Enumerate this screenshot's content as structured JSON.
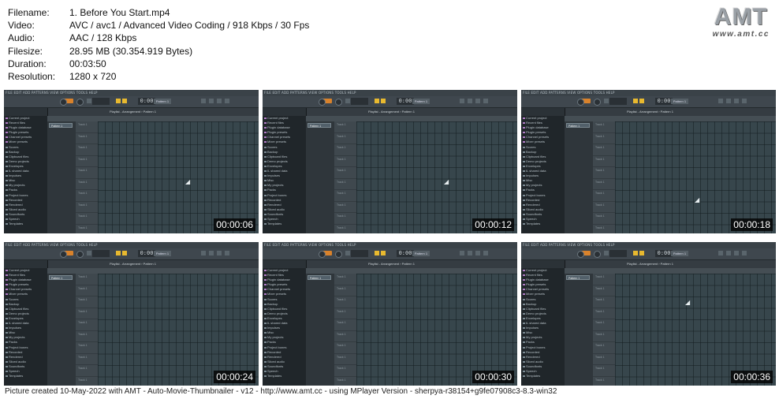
{
  "info": {
    "filename_label": "Filename:",
    "filename": "1. Before You Start.mp4",
    "video_label": "Video:",
    "video": "AVC / avc1 / Advanced Video Coding / 918 Kbps / 30 Fps",
    "audio_label": "Audio:",
    "audio": "AAC / 128 Kbps",
    "filesize_label": "Filesize:",
    "filesize": "28.95 MB (30.354.919 Bytes)",
    "duration_label": "Duration:",
    "duration": "00:03:50",
    "resolution_label": "Resolution:",
    "resolution": "1280 x 720"
  },
  "logo": {
    "text": "AMT",
    "url": "www.amt.cc"
  },
  "thumbnails": [
    {
      "timestamp": "00:00:06"
    },
    {
      "timestamp": "00:00:12"
    },
    {
      "timestamp": "00:00:18"
    },
    {
      "timestamp": "00:00:24"
    },
    {
      "timestamp": "00:00:30"
    },
    {
      "timestamp": "00:00:36"
    }
  ],
  "app": {
    "menu": "FILE EDIT ADD PATTERNS VIEW OPTIONS TOOLS HELP",
    "time": "0:00",
    "pattern_button": "Pattern 1",
    "breadcrumb": "Playlist - Arrangement › Pattern 1",
    "playlist_pattern": "Pattern 1",
    "browser_items": [
      "Current project",
      "Recent files",
      "Plugin database",
      "Plugin presets",
      "Channel presets",
      "Mixer presets",
      "Scores",
      "Backup",
      "Clipboard files",
      "Demo projects",
      "Envelopes",
      "IL shared data",
      "Impulses",
      "Misc",
      "My projects",
      "Packs",
      "Project bones",
      "Recorded",
      "Rendered",
      "Sliced audio",
      "Soundfonts",
      "Speech",
      "Templates"
    ],
    "track_label": "Track 1"
  },
  "footer": "Picture created 10-May-2022 with AMT - Auto-Movie-Thumbnailer - v12 - http://www.amt.cc - using MPlayer Version - sherpya-r38154+g9fe07908c3-8.3-win32"
}
